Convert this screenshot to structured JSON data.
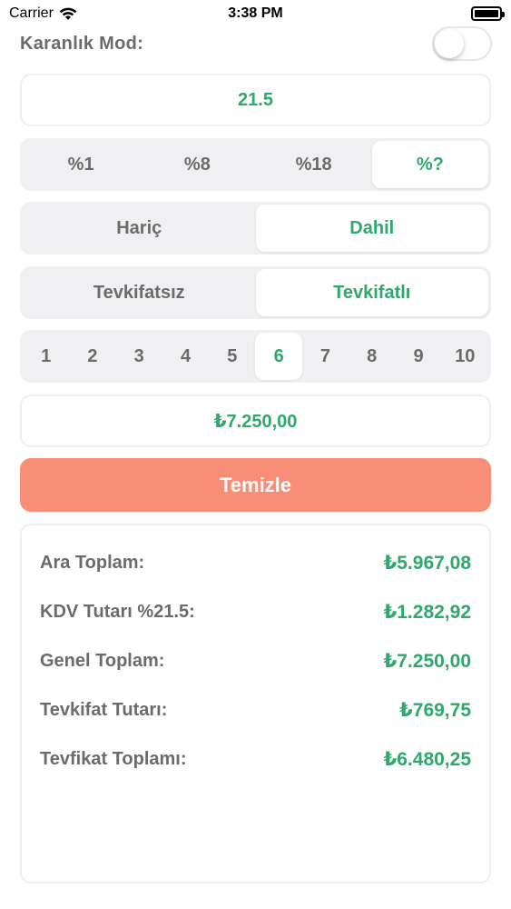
{
  "status_bar": {
    "carrier": "Carrier",
    "time": "3:38 PM"
  },
  "dark_mode": {
    "label": "Karanlık Mod:",
    "enabled": false
  },
  "rate_input": {
    "value": "21.5"
  },
  "rate_options": {
    "items": [
      "%1",
      "%8",
      "%18",
      "%?"
    ],
    "selected_index": 3
  },
  "tax_mode": {
    "items": [
      "Hariç",
      "Dahil"
    ],
    "selected_index": 1
  },
  "withholding_mode": {
    "items": [
      "Tevkifatsız",
      "Tevkifatlı"
    ],
    "selected_index": 1
  },
  "withholding_ratio": {
    "items": [
      "1",
      "2",
      "3",
      "4",
      "5",
      "6",
      "7",
      "8",
      "9",
      "10"
    ],
    "selected_index": 5
  },
  "amount_input": {
    "value": "₺7.250,00"
  },
  "clear_button": {
    "label": "Temizle"
  },
  "results": [
    {
      "label": "Ara Toplam:",
      "value": "₺5.967,08"
    },
    {
      "label": "KDV Tutarı %21.5:",
      "value": "₺1.282,92"
    },
    {
      "label": "Genel Toplam:",
      "value": "₺7.250,00"
    },
    {
      "label": "Tevkifat Tutarı:",
      "value": "₺769,75"
    },
    {
      "label": "Tevfikat Toplamı:",
      "value": "₺6.480,25"
    }
  ],
  "colors": {
    "accent_green": "#2ea86b",
    "clear_button": "#f98e78",
    "label_gray": "#6b6b6b"
  }
}
